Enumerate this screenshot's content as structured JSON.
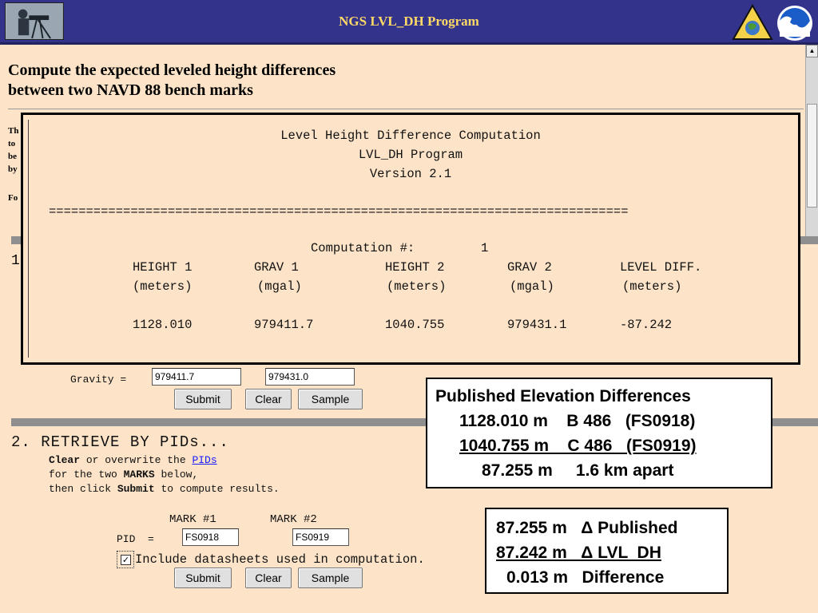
{
  "header": {
    "title": "NGS LVL_DH Program"
  },
  "page": {
    "heading_line1": "Compute the expected leveled height differences",
    "heading_line2": "between two NAVD 88 bench marks",
    "partial_lines": [
      "Th",
      "to",
      "be",
      "by",
      "Fo"
    ]
  },
  "result": {
    "title1": "Level Height Difference Computation",
    "title2": "LVL_DH Program",
    "title3": "Version 2.1",
    "separator": "==============================================================================",
    "computation_label": "Computation #:",
    "computation_number": "1",
    "columns": [
      {
        "header": "HEIGHT 1",
        "unit": "(meters)",
        "value": "1128.010"
      },
      {
        "header": "GRAV 1",
        "unit": "(mgal)",
        "value": "979411.7"
      },
      {
        "header": "HEIGHT 2",
        "unit": "(meters)",
        "value": "1040.755"
      },
      {
        "header": "GRAV 2",
        "unit": "(mgal)",
        "value": "979431.1"
      },
      {
        "header": "LEVEL DIFF.",
        "unit": "(meters)",
        "value": "-87.242"
      }
    ]
  },
  "step1": {
    "number": "1",
    "gravity_label": "Gravity =",
    "gravity1_value": "979411.7",
    "gravity2_value": "979431.0",
    "submit_label": "Submit",
    "clear_label": "Clear",
    "sample_label": "Sample"
  },
  "step2": {
    "title": "2. RETRIEVE BY PIDs...",
    "line1_bold": "Clear",
    "line1_mid": " or overwrite the ",
    "line1_link": "PIDs",
    "line2_pre": "for the two ",
    "line2_bold": "MARKS",
    "line2_post": " below,",
    "line3_pre": "then click ",
    "line3_bold": "Submit",
    "line3_post": " to compute results.",
    "mark1_header": "MARK #1",
    "mark2_header": "MARK #2",
    "pid_label": "PID  =",
    "pid1_value": "FS0918",
    "pid2_value": "FS0919",
    "checkbox_checked": true,
    "checkbox_label": "Include datasheets used in computation.",
    "submit_label": "Submit",
    "clear_label": "Clear",
    "sample_label": "Sample"
  },
  "published": {
    "title": "Published Elevation Differences",
    "row1": "1128.010 m    B 486   (FS0918)",
    "row2": "1040.755 m    C 486   (FS0919)",
    "row3": "87.255 m     1.6 km apart"
  },
  "comparison": {
    "row1": "87.255 m   Δ Published",
    "row2": "87.242 m   Δ LVL  DH",
    "row3": "0.013 m   Difference"
  },
  "colors": {
    "background": "#fde4c8",
    "title_bar": "#33338c",
    "title_text": "#ffd966",
    "section_bar": "#8f8f8f",
    "link": "#1a1aff"
  }
}
